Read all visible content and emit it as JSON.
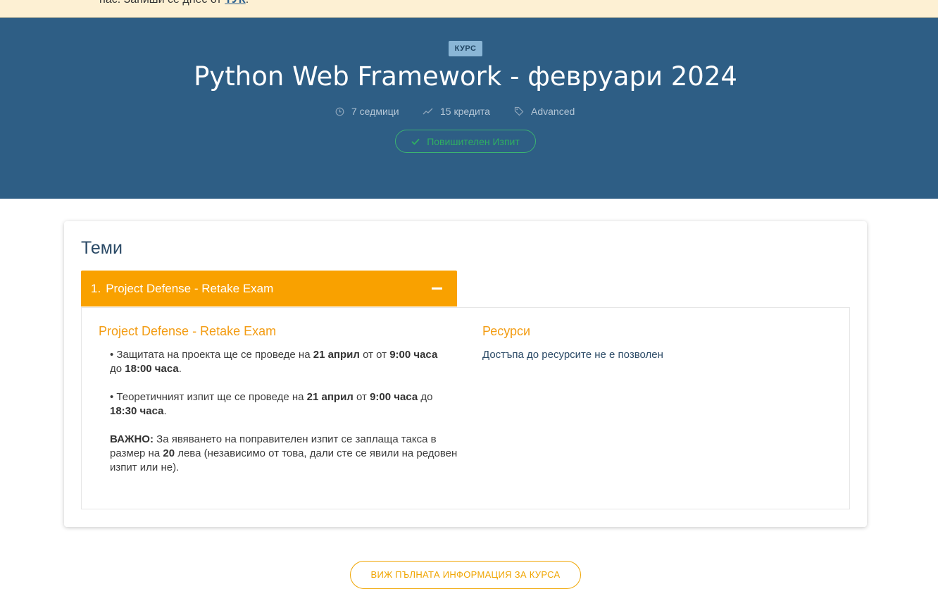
{
  "notice": {
    "text_before": "нас. Запиши се днес от ",
    "link_text": "ТУК",
    "text_after": "."
  },
  "hero": {
    "badge": "КУРС",
    "title": "Python Web Framework - февруари 2024",
    "meta": {
      "duration": "7 седмици",
      "credits": "15 кредита",
      "level": "Advanced"
    },
    "exam_button": "Повишителен Изпит"
  },
  "topics": {
    "section_title": "Теми",
    "items": [
      {
        "number": "1.",
        "title": "Project Defense - Retake Exam",
        "detail_title": "Project Defense - Retake Exam",
        "p1": {
          "t1": "• Защитата на проекта ще се проведе на ",
          "b1": "21 април",
          "t2": " от от ",
          "b2": "9:00 часа",
          "t3": " до ",
          "b3": "18:00 часа",
          "t4": "."
        },
        "p2": {
          "t1": "• Теоретичният изпит ще се проведе на ",
          "b1": "21 април",
          "t2": " от ",
          "b2": "9:00 часа",
          "t3": " до ",
          "b3": "18:30 часа",
          "t4": "."
        },
        "p3": {
          "b1": "ВАЖНО:",
          "t1": " За явяването на поправителен изпит се заплаща такса в размер на ",
          "b2": "20",
          "t2": " лева (независимо от това, дали сте се явили на редовен изпит или не)."
        },
        "resources_title": "Ресурси",
        "resources_text": "Достъпа до ресурсите не е позволен"
      }
    ]
  },
  "more_button": "ВИЖ ПЪЛНАТА ИНФОРМАЦИЯ ЗА КУРСА",
  "colors": {
    "hero_bg": "#2e5e85",
    "accent_orange": "#f9a100",
    "exam_green": "#3cb371",
    "notice_bg": "#fdf0d3"
  },
  "icons": [
    "clock-icon",
    "trend-icon",
    "tag-icon",
    "check-icon",
    "collapse-minus-icon"
  ]
}
